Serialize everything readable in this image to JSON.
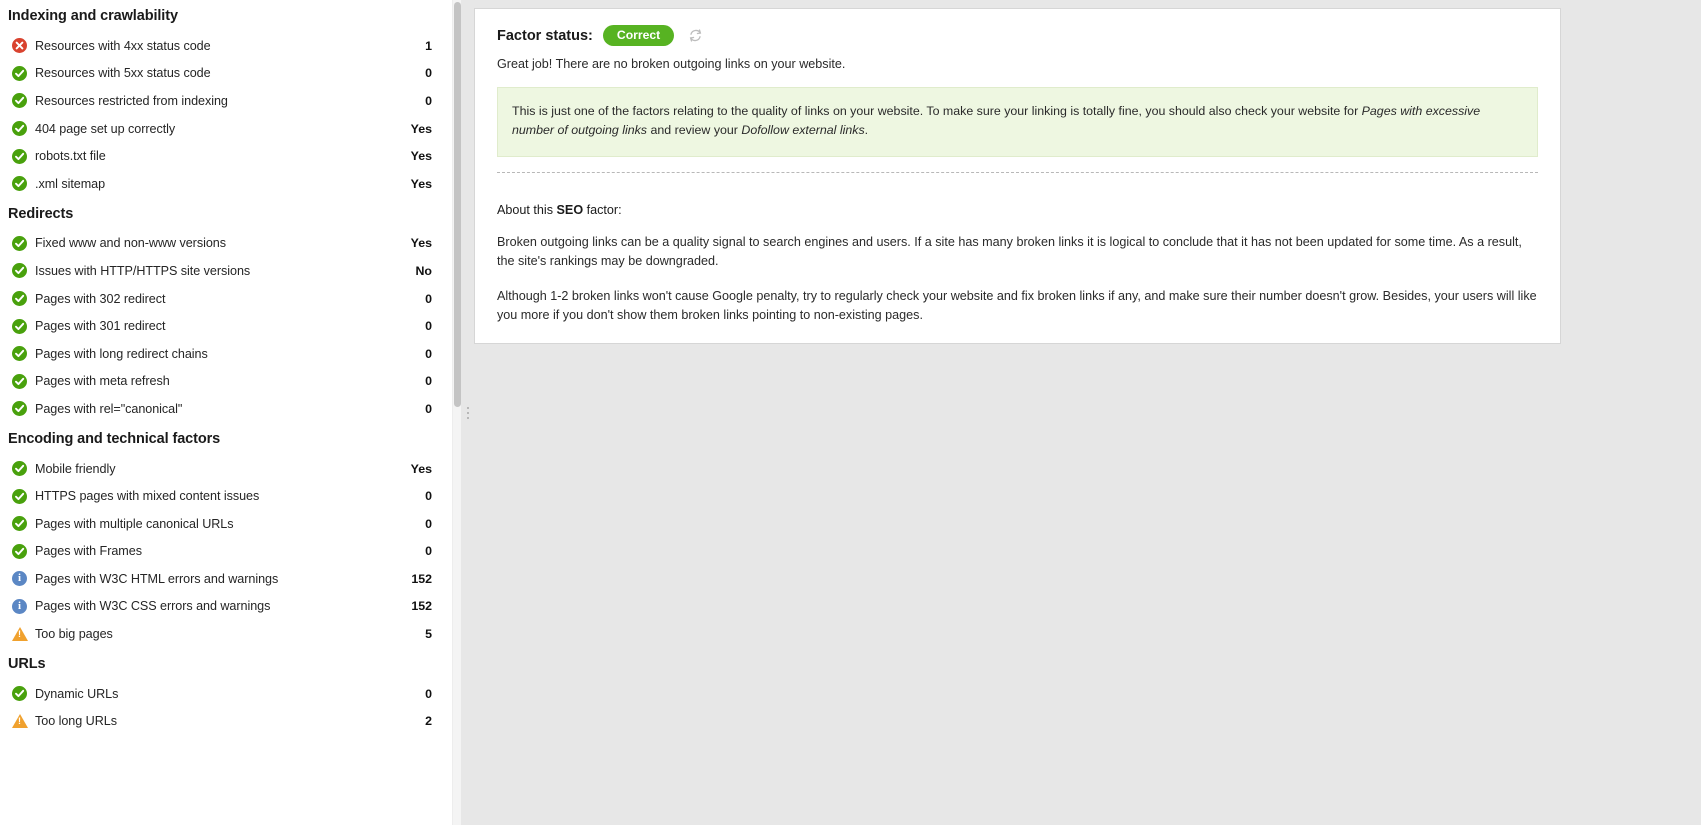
{
  "left_panel": {
    "groups": [
      {
        "title": "Indexing and crawlability",
        "rows": [
          {
            "icon": "error-icon",
            "label": "Resources with 4xx status code",
            "value": "1"
          },
          {
            "icon": "check-icon",
            "label": "Resources with 5xx status code",
            "value": "0"
          },
          {
            "icon": "check-icon",
            "label": "Resources restricted from indexing",
            "value": "0"
          },
          {
            "icon": "check-icon",
            "label": "404 page set up correctly",
            "value": "Yes"
          },
          {
            "icon": "check-icon",
            "label": "robots.txt file",
            "value": "Yes"
          },
          {
            "icon": "check-icon",
            "label": ".xml sitemap",
            "value": "Yes"
          }
        ]
      },
      {
        "title": "Redirects",
        "rows": [
          {
            "icon": "check-icon",
            "label": "Fixed www and non-www versions",
            "value": "Yes"
          },
          {
            "icon": "check-icon",
            "label": "Issues with HTTP/HTTPS site versions",
            "value": "No"
          },
          {
            "icon": "check-icon",
            "label": "Pages with 302 redirect",
            "value": "0"
          },
          {
            "icon": "check-icon",
            "label": "Pages with 301 redirect",
            "value": "0"
          },
          {
            "icon": "check-icon",
            "label": "Pages with long redirect chains",
            "value": "0"
          },
          {
            "icon": "check-icon",
            "label": "Pages with meta refresh",
            "value": "0"
          },
          {
            "icon": "check-icon",
            "label": "Pages with rel=\"canonical\"",
            "value": "0"
          }
        ]
      },
      {
        "title": "Encoding and technical factors",
        "rows": [
          {
            "icon": "check-icon",
            "label": "Mobile friendly",
            "value": "Yes"
          },
          {
            "icon": "check-icon",
            "label": "HTTPS pages with mixed content issues",
            "value": "0"
          },
          {
            "icon": "check-icon",
            "label": "Pages with multiple canonical URLs",
            "value": "0"
          },
          {
            "icon": "check-icon",
            "label": "Pages with Frames",
            "value": "0"
          },
          {
            "icon": "info-icon",
            "label": "Pages with W3C HTML errors and warnings",
            "value": "152"
          },
          {
            "icon": "info-icon",
            "label": "Pages with W3C CSS errors and warnings",
            "value": "152"
          },
          {
            "icon": "warning-icon",
            "label": "Too big pages",
            "value": "5"
          }
        ]
      },
      {
        "title": "URLs",
        "rows": [
          {
            "icon": "check-icon",
            "label": "Dynamic URLs",
            "value": "0"
          },
          {
            "icon": "warning-icon",
            "label": "Too long URLs",
            "value": "2"
          }
        ]
      }
    ]
  },
  "detail": {
    "status_label": "Factor status:",
    "status_value": "Correct",
    "refresh_icon": "refresh-icon",
    "status_description": "Great job! There are no broken outgoing links on your website.",
    "note": {
      "part1": "This is just one of the factors relating to the quality of links on your website. To make sure your linking is totally fine, you should also check your website for ",
      "emphasis1": "Pages with excessive number of outgoing links",
      "part2": " and review your ",
      "emphasis2": "Dofollow external links",
      "part3": "."
    },
    "about_title_prefix": "About this ",
    "about_title_bold": "SEO",
    "about_title_suffix": " factor:",
    "about_paragraphs": [
      "Broken outgoing links can be a quality signal to search engines and users. If a site has many broken links it is logical to conclude that it has not been updated for some time. As a result, the site's rankings may be downgraded.",
      "Although 1-2 broken links won't cause Google penalty, try to regularly check your website and fix broken links if any, and make sure their number doesn't grow. Besides, your users will like you more if you don't show them broken links pointing to non-existing pages."
    ]
  },
  "colors": {
    "ok": "#49a10d",
    "error": "#d9432f",
    "info": "#5b87c4",
    "warning": "#f0a12e",
    "pill": "#57b322",
    "note_bg": "#eef7e1"
  }
}
